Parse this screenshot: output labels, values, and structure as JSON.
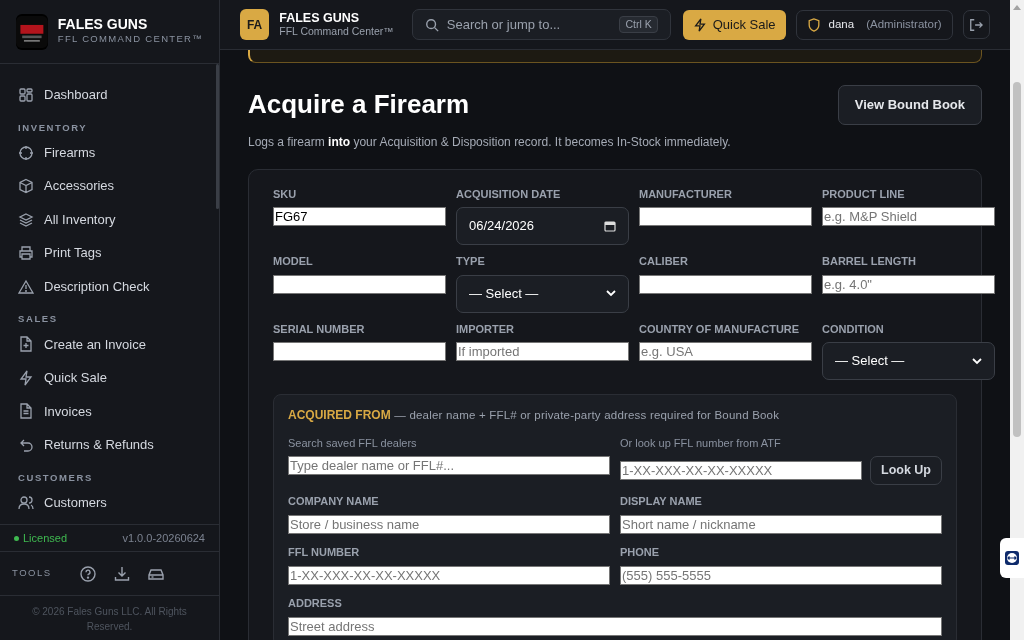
{
  "sidebar": {
    "brand": {
      "title": "FALES GUNS",
      "subtitle": "FFL COMMAND CENTER™"
    },
    "sections": [
      {
        "items": [
          {
            "label": "Dashboard",
            "selected": false
          }
        ]
      },
      {
        "heading": "INVENTORY",
        "items": [
          {
            "label": "Firearms",
            "selected": false
          },
          {
            "label": "Accessories",
            "selected": false
          },
          {
            "label": "All Inventory",
            "selected": false
          },
          {
            "label": "Print Tags",
            "selected": false
          },
          {
            "label": "Description Check",
            "selected": false
          }
        ]
      },
      {
        "heading": "SALES",
        "items": [
          {
            "label": "Create an Invoice",
            "selected": false
          },
          {
            "label": "Quick Sale",
            "selected": false
          },
          {
            "label": "Invoices",
            "selected": false
          },
          {
            "label": "Returns & Refunds",
            "selected": false
          }
        ]
      },
      {
        "heading": "CUSTOMERS",
        "items": [
          {
            "label": "Customers",
            "selected": false
          }
        ]
      }
    ],
    "license": "Licensed",
    "version": "v1.0.0-20260624",
    "tools_label": "TOOLS",
    "copyright": "© 2026 Fales Guns LLC. All Rights Reserved."
  },
  "topbar": {
    "avatar": "FA",
    "title": "FALES GUNS",
    "subtitle": "FFL Command Center™",
    "search": {
      "placeholder": "Search or jump to...",
      "shortcut": "Ctrl K"
    },
    "quick_sale": "Quick Sale",
    "user": "dana",
    "role": "(Administrator)"
  },
  "page": {
    "title": "Acquire a Firearm",
    "action": "View Bound Book",
    "intro": "Logs a firearm **into** your Acquisition & Disposition record. It becomes In-Stock immediately."
  },
  "fields": [
    {
      "label": "SKU",
      "kind": "text",
      "value": "FG67"
    },
    {
      "label": "ACQUISITION DATE",
      "kind": "date",
      "value": "06/24/2026"
    },
    {
      "label": "MANUFACTURER",
      "kind": "text"
    },
    {
      "label": "PRODUCT LINE",
      "kind": "text",
      "placeholder": "e.g. M&P Shield"
    },
    {
      "label": "MODEL",
      "kind": "text"
    },
    {
      "label": "TYPE",
      "kind": "select",
      "value": "— Select —"
    },
    {
      "label": "CALIBER",
      "kind": "text"
    },
    {
      "label": "BARREL LENGTH",
      "kind": "text",
      "placeholder": "e.g. 4.0\""
    },
    {
      "label": "SERIAL NUMBER",
      "kind": "text"
    },
    {
      "label": "IMPORTER",
      "kind": "text",
      "placeholder": "If imported"
    },
    {
      "label": "COUNTRY OF MANUFACTURE",
      "kind": "text",
      "placeholder": "e.g. USA"
    },
    {
      "label": "CONDITION",
      "kind": "select",
      "value": "— Select —"
    }
  ],
  "acquired_from": {
    "title": "ACQUIRED FROM",
    "note": "— dealer name + FFL# or private-party address required for Bound Book",
    "search_label": "Search saved FFL dealers",
    "search_placeholder": "Type dealer name or FFL#...",
    "lookup_label": "Or look up FFL number from ATF",
    "lookup_placeholder": "1-XX-XXX-XX-XX-XXXXX",
    "lookup_button": "Look Up",
    "fields": [
      {
        "label": "COMPANY NAME",
        "placeholder": "Store / business name"
      },
      {
        "label": "DISPLAY NAME",
        "placeholder": "Short name / nickname"
      },
      {
        "label": "FFL NUMBER",
        "placeholder": "1-XX-XXX-XX-XX-XXXXX"
      },
      {
        "label": "PHONE",
        "placeholder": "(555) 555-5555"
      }
    ],
    "address": {
      "label": "ADDRESS",
      "placeholder": "Street address"
    }
  }
}
